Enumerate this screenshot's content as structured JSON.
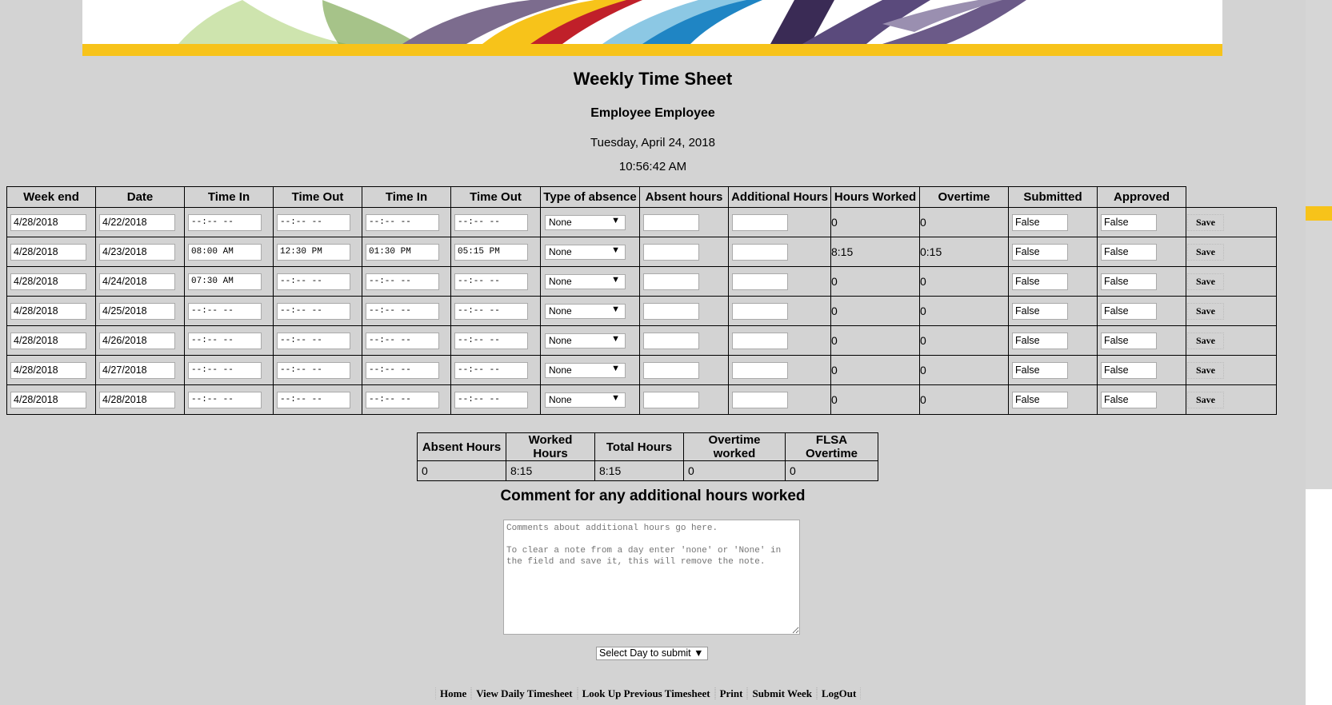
{
  "page": {
    "title": "Weekly Time Sheet",
    "employee": "Employee Employee",
    "date": "Tuesday, April 24, 2018",
    "time": "10:56:42 AM"
  },
  "columns": [
    "Week end",
    "Date",
    "Time In",
    "Time Out",
    "Time In",
    "Time Out",
    "Type of absence",
    "Absent hours",
    "Additional Hours",
    "Hours Worked",
    "Overtime",
    "Submitted",
    "Approved"
  ],
  "rows": [
    {
      "week_end": "4/28/2018",
      "date": "4/22/2018",
      "in1": "--:-- --",
      "out1": "--:-- --",
      "in2": "--:-- --",
      "out2": "--:-- --",
      "absence": "None",
      "absent_hours": "",
      "additional_hours": "",
      "hours_worked": "0",
      "overtime": "0",
      "submitted": "False",
      "approved": "False"
    },
    {
      "week_end": "4/28/2018",
      "date": "4/23/2018",
      "in1": "08:00 AM",
      "out1": "12:30 PM",
      "in2": "01:30 PM",
      "out2": "05:15 PM",
      "absence": "None",
      "absent_hours": "",
      "additional_hours": "",
      "hours_worked": "8:15",
      "overtime": "0:15",
      "submitted": "False",
      "approved": "False"
    },
    {
      "week_end": "4/28/2018",
      "date": "4/24/2018",
      "in1": "07:30 AM",
      "out1": "--:-- --",
      "in2": "--:-- --",
      "out2": "--:-- --",
      "absence": "None",
      "absent_hours": "",
      "additional_hours": "",
      "hours_worked": "0",
      "overtime": "0",
      "submitted": "False",
      "approved": "False"
    },
    {
      "week_end": "4/28/2018",
      "date": "4/25/2018",
      "in1": "--:-- --",
      "out1": "--:-- --",
      "in2": "--:-- --",
      "out2": "--:-- --",
      "absence": "None",
      "absent_hours": "",
      "additional_hours": "",
      "hours_worked": "0",
      "overtime": "0",
      "submitted": "False",
      "approved": "False"
    },
    {
      "week_end": "4/28/2018",
      "date": "4/26/2018",
      "in1": "--:-- --",
      "out1": "--:-- --",
      "in2": "--:-- --",
      "out2": "--:-- --",
      "absence": "None",
      "absent_hours": "",
      "additional_hours": "",
      "hours_worked": "0",
      "overtime": "0",
      "submitted": "False",
      "approved": "False"
    },
    {
      "week_end": "4/28/2018",
      "date": "4/27/2018",
      "in1": "--:-- --",
      "out1": "--:-- --",
      "in2": "--:-- --",
      "out2": "--:-- --",
      "absence": "None",
      "absent_hours": "",
      "additional_hours": "",
      "hours_worked": "0",
      "overtime": "0",
      "submitted": "False",
      "approved": "False"
    },
    {
      "week_end": "4/28/2018",
      "date": "4/28/2018",
      "in1": "--:-- --",
      "out1": "--:-- --",
      "in2": "--:-- --",
      "out2": "--:-- --",
      "absence": "None",
      "absent_hours": "",
      "additional_hours": "",
      "hours_worked": "0",
      "overtime": "0",
      "submitted": "False",
      "approved": "False"
    }
  ],
  "save_label": "Save",
  "summary": {
    "headers": [
      "Absent Hours",
      "Worked Hours",
      "Total Hours",
      "Overtime worked",
      "FLSA Overtime"
    ],
    "values": [
      "0",
      "8:15",
      "8:15",
      "0",
      "0"
    ]
  },
  "comment": {
    "heading": "Comment for any additional hours worked",
    "placeholder": "Comments about additional hours go here.\n\nTo clear a note from a day enter 'none' or 'None' in the field and save it, this will remove the note."
  },
  "day_select": {
    "label": "Select Day to submit",
    "arrow": "▼"
  },
  "nav": [
    "Home",
    "View Daily Timesheet",
    "Look Up Previous Timesheet",
    "Print",
    "Submit Week",
    "LogOut"
  ],
  "colors": {
    "background": "#d3d3d3",
    "banner_stripe": "#f7c31a"
  },
  "icons": {
    "select_arrow": "▼"
  }
}
